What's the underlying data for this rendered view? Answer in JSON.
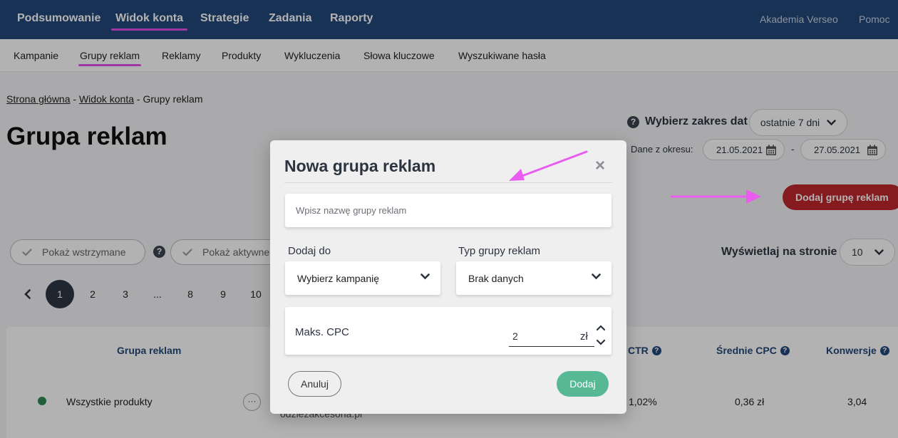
{
  "topnav": {
    "items": [
      "Podsumowanie",
      "Widok konta",
      "Strategie",
      "Zadania",
      "Raporty"
    ],
    "right": [
      "Akademia Verseo",
      "Pomoc"
    ],
    "active_index": 1
  },
  "subnav": {
    "items": [
      "Kampanie",
      "Grupy reklam",
      "Reklamy",
      "Produkty",
      "Wykluczenia",
      "Słowa kluczowe",
      "Wyszukiwane hasła"
    ],
    "active_index": 1
  },
  "breadcrumb": {
    "home": "Strona główna",
    "account": "Widok konta",
    "current": "Grupy reklam",
    "sep": " - "
  },
  "page_title": "Grupa reklam",
  "date_range": {
    "label": "Wybierz zakres dat",
    "selected": "ostatnie 7 dni",
    "period_label": "Dane z okresu:",
    "from": "21.05.2021",
    "to": "27.05.2021",
    "sep": "-"
  },
  "add_group_button": "Dodaj grupę reklam",
  "filters": {
    "paused": "Pokaż wstrzymane",
    "active": "Pokaż aktywne"
  },
  "per_page": {
    "label": "Wyświetlaj na stronie",
    "value": "10"
  },
  "pagination": {
    "pages": [
      "1",
      "2",
      "3",
      "...",
      "8",
      "9",
      "10"
    ],
    "active": "1"
  },
  "table": {
    "headers": {
      "group": "Grupa reklam",
      "ctr": "CTR",
      "avg_cpc": "Średnie CPC",
      "conversions": "Konwersje"
    },
    "row": {
      "name": "Wszystkie produkty",
      "campaign": "odziezakcesoria.pl",
      "ctr": "1,02%",
      "avg_cpc": "0,36 zł",
      "conversions": "3,04"
    }
  },
  "modal": {
    "title": "Nowa grupa reklam",
    "close": "×",
    "name_placeholder": "Wpisz nazwę grupy reklam",
    "add_to_label": "Dodaj do",
    "add_to_value": "Wybierz kampanię",
    "type_label": "Typ grupy reklam",
    "type_value": "Brak danych",
    "max_cpc_label": "Maks. CPC",
    "max_cpc_value": "2",
    "currency": "zł",
    "cancel": "Anuluj",
    "submit": "Dodaj"
  },
  "colors": {
    "nav_bg": "#23487a",
    "accent": "#e34fe8",
    "primary_red": "#c0272d",
    "submit_green": "#56b894",
    "status_active": "#2e8b57"
  }
}
